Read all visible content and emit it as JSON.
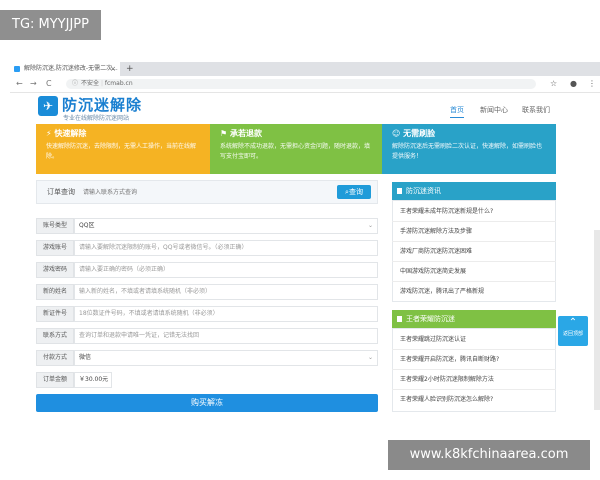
{
  "watermark_top": "TG: MYYJJPP",
  "watermark_bottom": "www.k8kfchinaarea.com",
  "browser": {
    "tab_title": "解除防沉迷,防沉迷修改-无需二次...",
    "tab_close": "×",
    "new_tab": "+",
    "back": "←",
    "forward": "→",
    "reload": "C",
    "security": "不安全",
    "url": "fcmab.cn",
    "star": "☆",
    "account": "●",
    "menu": "⋮"
  },
  "site": {
    "logo_icon": "✈",
    "logo_title": "防沉迷解除",
    "logo_subtitle": "专业在线解除防沉迷网站",
    "nav": [
      "首页",
      "新闻中心",
      "联系我们"
    ]
  },
  "features": [
    {
      "title": "快速解除",
      "desc": "快速解除防沉迷，去除限制，无需人工操作，当前在线解除。",
      "color": "#f5b323"
    },
    {
      "title": "承若退款",
      "desc": "系统解除不成功退款，无需担心资金问题，随时退款，填写支付宝即可。",
      "color": "#7fc144"
    },
    {
      "title": "无需刷脸",
      "desc": "解除防沉迷后无需刷脸二次认证，快速解除，如需刷脸也提供服务！",
      "color": "#29a2c8"
    }
  ],
  "query": {
    "label": "订单查询",
    "placeholder": "请输入联系方式查询",
    "button": "查询",
    "button_icon": "⌕"
  },
  "form": {
    "rows": [
      {
        "label": "账号类型",
        "value": "QQ区",
        "placeholder": "",
        "select": true
      },
      {
        "label": "游戏账号",
        "value": "",
        "placeholder": "请输入要解除沉迷限制的账号，QQ号或者微信号。（必须正确）",
        "select": false
      },
      {
        "label": "游戏密码",
        "value": "",
        "placeholder": "请输入要正确的密码（必须正确）",
        "select": false
      },
      {
        "label": "新的姓名",
        "value": "",
        "placeholder": "输入新的姓名，不填或者请填系统随机（非必须）",
        "select": false
      },
      {
        "label": "新证件号",
        "value": "",
        "placeholder": "18位数证件号码，不填或者请填系统随机（非必须）",
        "select": false
      },
      {
        "label": "联系方式",
        "value": "",
        "placeholder": "查询订单和退款申请唯一凭证，记错无法找回",
        "select": false
      },
      {
        "label": "付款方式",
        "value": "微信",
        "placeholder": "",
        "select": true
      },
      {
        "label": "订单金额",
        "value": "￥30.00元",
        "placeholder": "",
        "select": false
      }
    ],
    "caret": "⌄",
    "buy_button": "购买解冻"
  },
  "sidebar": {
    "news_title": "防沉迷资讯",
    "news_color": "#29a2c8",
    "news": [
      "王者荣耀未成年防沉迷新规是什么?",
      "手游防沉迷解除方法及步骤",
      "游戏厂商防沉迷防沉迷困难",
      "中国游戏防沉迷简史发展",
      "游戏防沉迷，腾讯出了严格新规"
    ],
    "honor_title": "王者荣耀防沉迷",
    "honor_color": "#7fc144",
    "honor": [
      "王者荣耀跳过防沉迷认证",
      "王者荣耀开启防沉迷，腾讯自断财路?",
      "王者荣耀2小时防沉迷限制解除方法",
      "王者荣耀人脸识别防沉迷怎么解除?"
    ]
  },
  "float_button": {
    "arrow": "⌃",
    "label": "返回顶部"
  }
}
